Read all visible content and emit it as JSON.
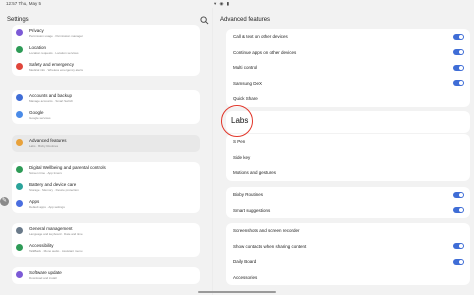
{
  "status_bar": {
    "time": "12:57",
    "date": "Thu, May 5",
    "icons": "▾ ◉ ▮"
  },
  "left_pane": {
    "title": "Settings",
    "groups": [
      {
        "items": [
          {
            "label": "Privacy",
            "sub": "Permission usage · Permission manager",
            "icon": "privacy-icon",
            "color": "#7c5ad6"
          },
          {
            "label": "Location",
            "sub": "Location requests · Location services",
            "icon": "location-icon",
            "color": "#2e9b57"
          },
          {
            "label": "Safety and emergency",
            "sub": "Medical info · Wireless emergency alerts",
            "icon": "safety-icon",
            "color": "#e0463b"
          }
        ]
      },
      {
        "items": [
          {
            "label": "Accounts and backup",
            "sub": "Manage accounts · Smart Switch",
            "icon": "accounts-icon",
            "color": "#3f6dd6"
          },
          {
            "label": "Google",
            "sub": "Google services",
            "icon": "google-icon",
            "color": "#4a8be8"
          }
        ]
      },
      {
        "items": [
          {
            "label": "Advanced features",
            "sub": "Labs · Bixby Routines",
            "icon": "advanced-features-icon",
            "color": "#e8a13a",
            "selected": true
          }
        ]
      },
      {
        "items": [
          {
            "label": "Digital Wellbeing and parental controls",
            "sub": "Screen time · App timers",
            "icon": "wellbeing-icon",
            "color": "#2e9b57"
          },
          {
            "label": "Battery and device care",
            "sub": "Storage · Memory · Device protection",
            "icon": "battery-icon",
            "color": "#2aa39a"
          },
          {
            "label": "Apps",
            "sub": "Default apps · App settings",
            "icon": "apps-icon",
            "color": "#4a6ee0"
          }
        ]
      },
      {
        "items": [
          {
            "label": "General management",
            "sub": "Language and keyboard · Date and time",
            "icon": "general-management-icon",
            "color": "#6a7a8a"
          },
          {
            "label": "Accessibility",
            "sub": "TalkBack · Mono audio · Assistant menu",
            "icon": "accessibility-icon",
            "color": "#2e9b57"
          }
        ]
      },
      {
        "items": [
          {
            "label": "Software update",
            "sub": "Download and install",
            "icon": "software-update-icon",
            "color": "#7c5ad6"
          }
        ]
      }
    ]
  },
  "right_pane": {
    "title": "Advanced features",
    "group1": [
      {
        "label": "Call & text on other devices",
        "toggle": true
      },
      {
        "label": "Continue apps on other devices",
        "toggle": true
      },
      {
        "label": "Multi control",
        "toggle": true
      },
      {
        "label": "Samsung DeX",
        "toggle": true
      },
      {
        "label": "Quick Share",
        "toggle": false
      }
    ],
    "labs_label": "Labs",
    "group3": [
      {
        "label": "S Pen",
        "toggle": false
      },
      {
        "label": "Side key",
        "toggle": false
      },
      {
        "label": "Motions and gestures",
        "toggle": false
      }
    ],
    "group4": [
      {
        "label": "Bixby Routines",
        "toggle": true
      },
      {
        "label": "Smart suggestions",
        "toggle": true
      }
    ],
    "group5": [
      {
        "label": "Screenshots and screen recorder",
        "toggle": false
      },
      {
        "label": "Show contacts when sharing content",
        "toggle": true
      },
      {
        "label": "Daily Board",
        "toggle": true
      },
      {
        "label": "Accessories",
        "toggle": false
      }
    ]
  },
  "colors": {
    "toggle_on": "#3f6dd6",
    "highlight_circle": "#e2372b"
  }
}
